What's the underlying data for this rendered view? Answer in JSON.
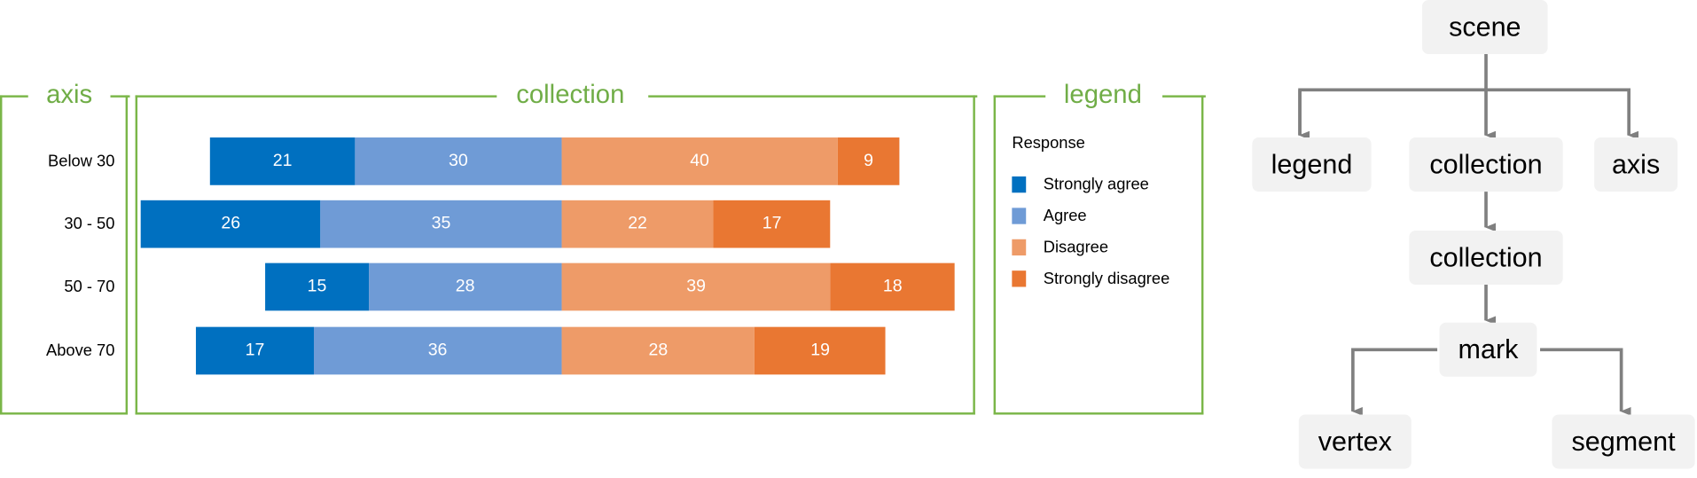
{
  "chart_data": {
    "type": "bar",
    "orientation": "horizontal",
    "stacked": "diverging",
    "categories": [
      "Below 30",
      "30 - 50",
      "50 - 70",
      "Above 70"
    ],
    "series": [
      {
        "name": "Strongly agree",
        "color": "#0070c0",
        "values": [
          21,
          26,
          15,
          17
        ]
      },
      {
        "name": "Agree",
        "color": "#6f9bd6",
        "values": [
          30,
          35,
          28,
          36
        ]
      },
      {
        "name": "Disagree",
        "color": "#ee9b68",
        "values": [
          40,
          22,
          39,
          28
        ]
      },
      {
        "name": "Strongly disagree",
        "color": "#e97732",
        "values": [
          9,
          17,
          18,
          19
        ]
      }
    ],
    "legend_title": "Response",
    "legend_placement": "right"
  },
  "panels": {
    "axis": "axis",
    "collection": "collection",
    "legend": "legend"
  },
  "accent_color": "#70ad47",
  "tree": {
    "root": "scene",
    "children": [
      "legend",
      "collection",
      "axis"
    ],
    "sub_collection": "collection",
    "mark": "mark",
    "mark_children": [
      "vertex",
      "segment"
    ]
  }
}
